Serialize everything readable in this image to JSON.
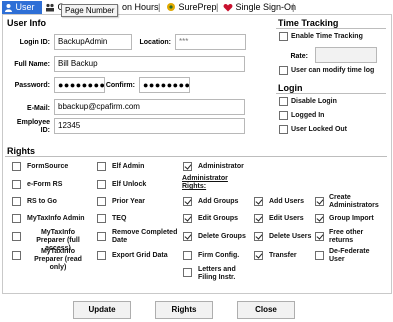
{
  "tabs": [
    {
      "label": "User"
    },
    {
      "label": "G"
    },
    {
      "label": "on Hours"
    },
    {
      "label": "SurePrep"
    },
    {
      "label": "Single Sign-On"
    }
  ],
  "tooltip": "Page Number",
  "user_info": {
    "title": "User Info",
    "login_id_label": "Login ID:",
    "login_id_value": "BackupAdmin",
    "location_label": "Location:",
    "location_value": "***",
    "full_name_label": "Full Name:",
    "full_name_value": "Bill Backup",
    "password_label": "Password:",
    "password_value": "●●●●●●●●",
    "confirm_label": "Confirm:",
    "confirm_value": "●●●●●●●●",
    "email_label": "E-Mail:",
    "email_value": "bbackup@cpafirm.com",
    "employee_id_label": "Employee ID:",
    "employee_id_value": "12345"
  },
  "time_tracking": {
    "title": "Time Tracking",
    "enable_label": "Enable Time Tracking",
    "rate_label": "Rate:",
    "rate_value": "",
    "modify_label": "User can modify time log"
  },
  "login": {
    "title": "Login",
    "disable_label": "Disable Login",
    "logged_in_label": "Logged In",
    "locked_out_label": "User Locked Out"
  },
  "rights": {
    "title": "Rights",
    "admin_rights_label": "Administrator Rights:",
    "items": [
      {
        "label": "FormSource",
        "checked": false
      },
      {
        "label": "e-Form RS",
        "checked": false
      },
      {
        "label": "RS to Go",
        "checked": false
      },
      {
        "label": "MyTaxInfo Admin",
        "checked": false
      },
      {
        "label": "MyTaxInfo Preparer (full access)",
        "checked": false
      },
      {
        "label": "MyTaxInfo Preparer (read only)",
        "checked": false
      },
      {
        "label": "Elf Admin",
        "checked": false
      },
      {
        "label": "Elf Unlock",
        "checked": false
      },
      {
        "label": "Prior Year",
        "checked": false
      },
      {
        "label": "TEQ",
        "checked": false
      },
      {
        "label": "Remove Completed Date",
        "checked": false
      },
      {
        "label": "Export Grid Data",
        "checked": false
      },
      {
        "label": "Administrator",
        "checked": true
      },
      {
        "label": "Add Groups",
        "checked": true
      },
      {
        "label": "Edit Groups",
        "checked": true
      },
      {
        "label": "Delete Groups",
        "checked": true
      },
      {
        "label": "Firm Config.",
        "checked": false
      },
      {
        "label": "Letters and Filing Instr.",
        "checked": false
      },
      {
        "label": "Add Users",
        "checked": true
      },
      {
        "label": "Edit Users",
        "checked": true
      },
      {
        "label": "Delete Users",
        "checked": true
      },
      {
        "label": "Transfer",
        "checked": true
      },
      {
        "label": "Create Administrators",
        "checked": true
      },
      {
        "label": "Group Import",
        "checked": true
      },
      {
        "label": "Free other returns",
        "checked": true
      },
      {
        "label": "De-Federate User",
        "checked": false
      }
    ]
  },
  "buttons": {
    "update": "Update",
    "rights": "Rights",
    "close": "Close"
  }
}
